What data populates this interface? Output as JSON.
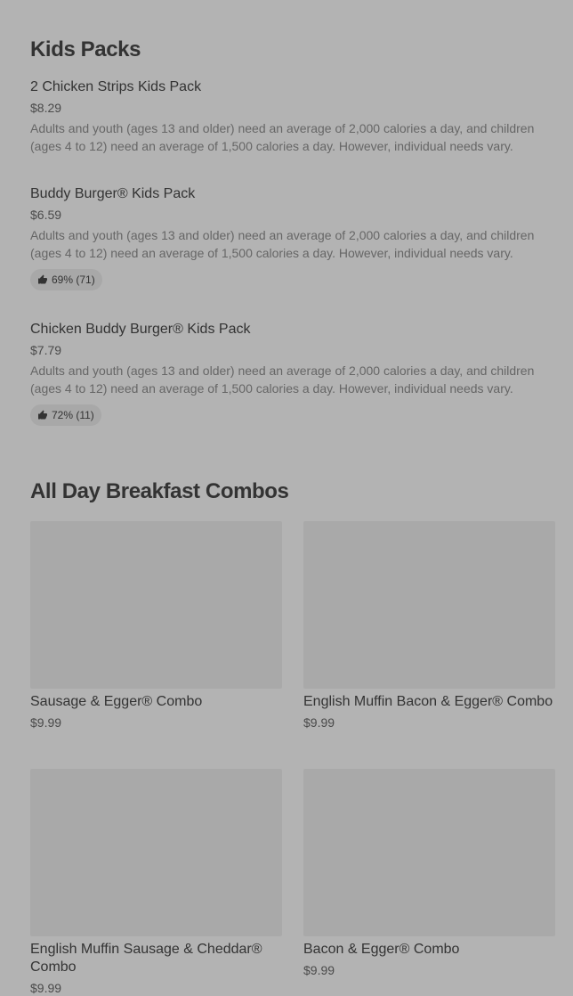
{
  "kids_section": {
    "title": "Kids Packs",
    "items": [
      {
        "name": "2 Chicken Strips Kids Pack",
        "price": "$8.29",
        "description": "Adults and youth (ages 13 and older) need an average of 2,000 calories a day, and children (ages 4 to 12) need an average of 1,500 calories a day. However, individual needs vary.",
        "rating": ""
      },
      {
        "name": "Buddy Burger® Kids Pack",
        "price": "$6.59",
        "description": "Adults and youth (ages 13 and older) need an average of 2,000 calories a day, and children (ages 4 to 12) need an average of 1,500 calories a day. However, individual needs vary.",
        "rating": "69% (71)"
      },
      {
        "name": "Chicken Buddy Burger® Kids Pack",
        "price": "$7.79",
        "description": "Adults and youth (ages 13 and older) need an average of 2,000 calories a day, and children (ages 4 to 12) need an average of 1,500 calories a day. However, individual needs vary.",
        "rating": "72% (11)"
      }
    ]
  },
  "breakfast_section": {
    "title": "All Day Breakfast Combos",
    "items": [
      {
        "name": "Sausage & Egger® Combo",
        "price": "$9.99"
      },
      {
        "name": "English Muffin Bacon & Egger® Combo",
        "price": "$9.99"
      },
      {
        "name": "English Muffin Sausage & Cheddar® Combo",
        "price": "$9.99"
      },
      {
        "name": "Bacon & Egger® Combo",
        "price": "$9.99"
      }
    ]
  },
  "icons": {
    "rating_icon": "thumbs-up-icon"
  },
  "colors": {
    "background": "#b3b3b3",
    "placeholder_image": "#a9a9a9",
    "rating_pill": "#a8a8a8"
  }
}
